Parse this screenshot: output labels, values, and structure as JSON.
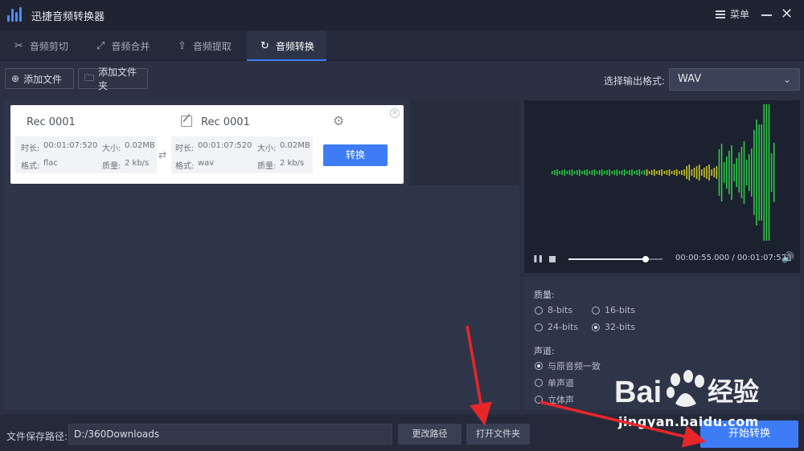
{
  "app": {
    "title": "迅捷音频转换器",
    "menu_label": "菜单"
  },
  "tabs": [
    {
      "label": "音频剪切",
      "icon": "scissors-icon",
      "active": false
    },
    {
      "label": "音频合并",
      "icon": "merge-icon",
      "active": false
    },
    {
      "label": "音频提取",
      "icon": "extract-icon",
      "active": false
    },
    {
      "label": "音频转换",
      "icon": "convert-icon",
      "active": true
    }
  ],
  "toolbar": {
    "add_file_label": "添加文件",
    "add_folder_label": "添加文件夹",
    "format_label": "选择输出格式:",
    "format_value": "WAV"
  },
  "file_card": {
    "source": {
      "name": "Rec 0001",
      "duration_label": "时长:",
      "duration": "00:01:07:520",
      "size_label": "大小:",
      "size": "0.02MB",
      "format_label": "格式:",
      "format": "flac",
      "quality_label": "质量:",
      "quality": "2 kb/s"
    },
    "target": {
      "name": "Rec 0001",
      "duration_label": "时长:",
      "duration": "00:01:07:520",
      "size_label": "大小:",
      "size": "0.02MB",
      "format_label": "格式:",
      "format": "wav",
      "quality_label": "质量:",
      "quality": "2 kb/s"
    },
    "convert_label": "转换"
  },
  "player": {
    "current_time": "00:00:55.000",
    "total_time": "00:01:07:520",
    "progress": 0.82,
    "wave_color_low": "#2ec946",
    "wave_color_mid": "#c9c62a"
  },
  "settings": {
    "quality_label": "质量:",
    "quality_options": [
      {
        "label": "8-bits",
        "selected": false
      },
      {
        "label": "16-bits",
        "selected": false
      },
      {
        "label": "24-bits",
        "selected": false
      },
      {
        "label": "32-bits",
        "selected": true
      }
    ],
    "channel_label": "声道:",
    "channel_options": [
      {
        "label": "与原音频一致",
        "selected": true
      },
      {
        "label": "单声道",
        "selected": false
      },
      {
        "label": "立体声",
        "selected": false
      }
    ]
  },
  "bottom": {
    "path_label": "文件保存路径:",
    "path_value": "D:/360Downloads",
    "change_path_label": "更改路径",
    "open_folder_label": "打开文件夹",
    "start_label": "开始转换"
  },
  "watermark": {
    "text": "jingyan.baidu.com"
  },
  "colors": {
    "accent": "#3d7cf5",
    "annotation": "#e8262a"
  }
}
